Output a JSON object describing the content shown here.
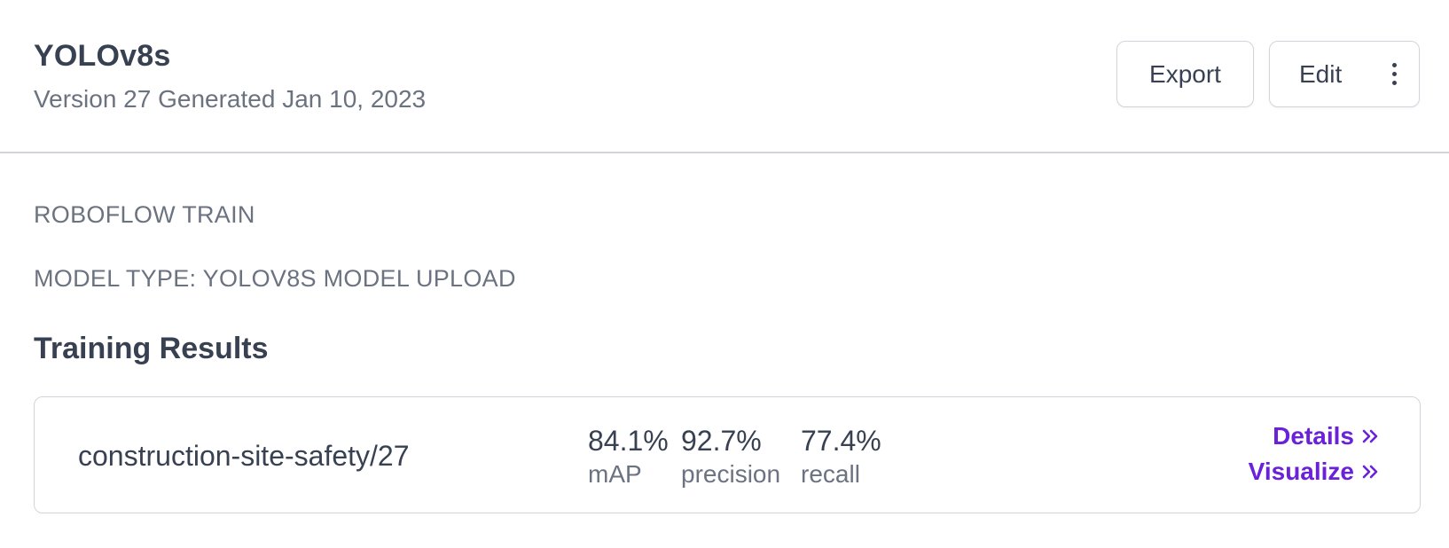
{
  "header": {
    "title": "YOLOv8s",
    "subtitle": "Version 27 Generated Jan 10, 2023",
    "export_label": "Export",
    "edit_label": "Edit",
    "more_icon": "kebab-menu-icon"
  },
  "meta": {
    "train_label": "ROBOFLOW TRAIN",
    "model_type_label": "MODEL TYPE: YOLOV8S MODEL UPLOAD"
  },
  "results": {
    "section_title": "Training Results",
    "model_name": "construction-site-safety/27",
    "metrics": [
      {
        "value": "84.1%",
        "label": "mAP"
      },
      {
        "value": "92.7%",
        "label": "precision"
      },
      {
        "value": "77.4%",
        "label": "recall"
      }
    ],
    "details_label": "Details",
    "visualize_label": "Visualize",
    "link_icon": "double-chevron-right-icon"
  },
  "colors": {
    "text_primary": "#374151",
    "text_secondary": "#6b7280",
    "border": "#d1d5db",
    "link": "#6b21d8"
  }
}
